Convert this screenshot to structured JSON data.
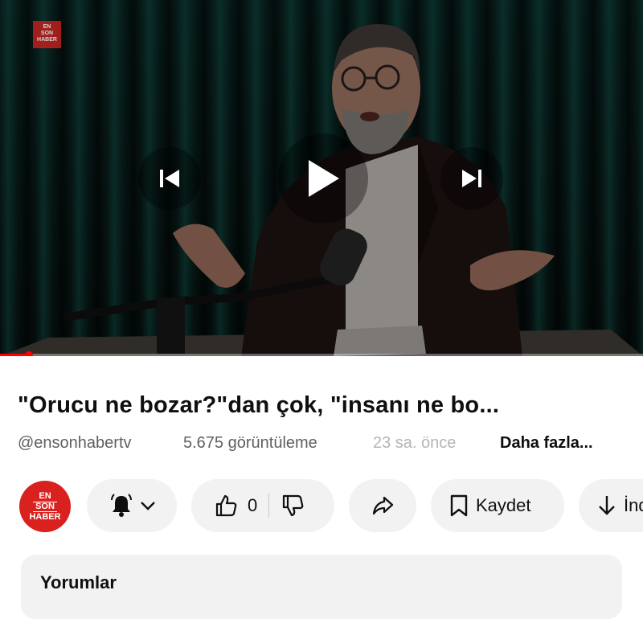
{
  "player": {
    "watermark_lines": [
      "EN",
      "SON",
      "HABER"
    ],
    "progress": 0.045,
    "controls": {
      "previous_icon": "skip-previous-icon",
      "play_icon": "play-icon",
      "next_icon": "skip-next-icon"
    }
  },
  "video": {
    "title": "\"Orucu ne bozar?\"dan çok, \"insanı ne bo...",
    "channel_handle": "@ensonhabertv",
    "views": "5.675 görüntüleme",
    "time_ago": "23 sa. önce",
    "more_label": "Daha fazla..."
  },
  "actions": {
    "avatar_lines": [
      "EN",
      "SON",
      "HABER"
    ],
    "bell_icon": "bell-icon",
    "like_count": "0",
    "save_label": "Kaydet",
    "download_label": "İndir"
  },
  "comments": {
    "title": "Yorumlar"
  },
  "colors": {
    "accent": "#ff0000",
    "brand": "#d9221f",
    "pill_bg": "#f2f2f2"
  }
}
